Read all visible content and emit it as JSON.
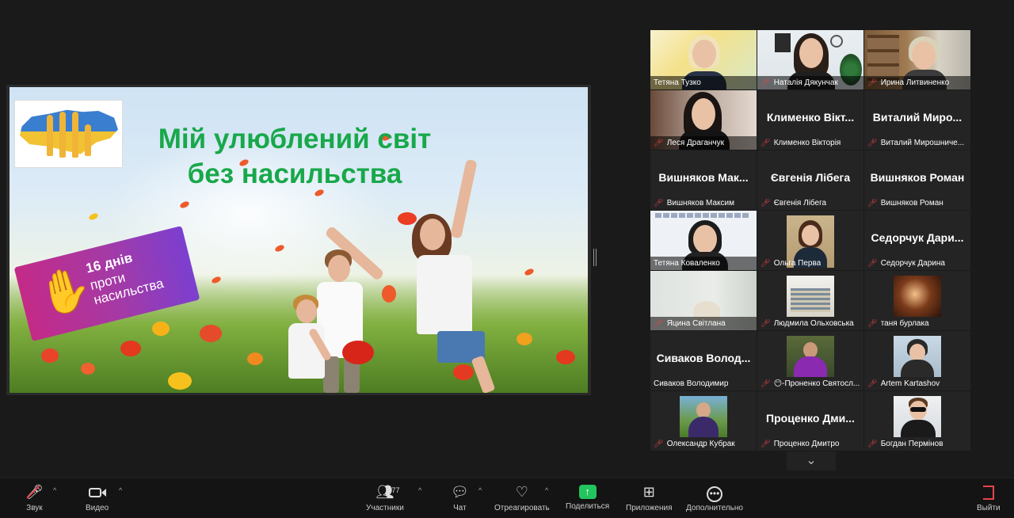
{
  "slide": {
    "title_line1": "Мій улюблений світ",
    "title_line2": "без насильства",
    "badge_line1": "16 днів",
    "badge_line2": "проти",
    "badge_line3": "насильства"
  },
  "participants": [
    {
      "name": "Тетяна Тузко",
      "muted": false,
      "video": true,
      "speaking": true
    },
    {
      "name": "Наталія Дякунчак",
      "muted": true,
      "video": true
    },
    {
      "name": "Ирина Литвиненко",
      "muted": true,
      "video": true
    },
    {
      "name": "Леся Драганчук",
      "muted": true,
      "video": true
    },
    {
      "name": "Клименко Вікторія",
      "big": "Клименко Вікт...",
      "muted": true,
      "video": false
    },
    {
      "name": "Виталий Мирошниче...",
      "big": "Виталий Миро...",
      "muted": true,
      "video": false
    },
    {
      "name": "Вишняков Максим",
      "big": "Вишняков Мак...",
      "muted": true,
      "video": false
    },
    {
      "name": "Євгенія Лібега",
      "big": "Євгенія Лібега",
      "muted": true,
      "video": false
    },
    {
      "name": "Вишняков Роман",
      "big": "Вишняков Роман",
      "muted": true,
      "video": false
    },
    {
      "name": "Тетяна  Коваленко",
      "muted": false,
      "video": true
    },
    {
      "name": "Ольга Перва",
      "muted": true,
      "video": true
    },
    {
      "name": "Седорчук Дарина",
      "big": "Седорчук Дари...",
      "muted": true,
      "video": false
    },
    {
      "name": "Яцина Світлана",
      "muted": true,
      "video": true
    },
    {
      "name": "Людмила Ольховська",
      "muted": true,
      "video": true
    },
    {
      "name": "таня бурлака",
      "muted": true,
      "video": true
    },
    {
      "name": "Сиваков Володимир",
      "big": "Сиваков Волод...",
      "muted": false,
      "video": false
    },
    {
      "name": "😶-Проненко Святосл...",
      "muted": true,
      "video": true
    },
    {
      "name": "Artem Kartashov",
      "muted": true,
      "video": true
    },
    {
      "name": "Олександр Кубрак",
      "muted": true,
      "video": true
    },
    {
      "name": "Проценко Дмитро",
      "big": "Проценко Дми...",
      "muted": true,
      "video": false
    },
    {
      "name": "Богдан Пермінов",
      "muted": true,
      "video": true
    }
  ],
  "toolbar": {
    "audio": "Звук",
    "video": "Видео",
    "participants": "Участники",
    "participants_count": "77",
    "chat": "Чат",
    "react": "Отреагировать",
    "share": "Поделиться",
    "apps": "Приложения",
    "more": "Дополнительно",
    "leave": "Выйти"
  },
  "colors": {
    "accent_green": "#23c55e",
    "muted_red": "#e8434a",
    "slide_title_green": "#18a84a"
  },
  "icons": {
    "audio": "mic-muted-icon",
    "video": "camera-icon",
    "participants": "people-icon",
    "chat": "chat-bubble-icon",
    "react": "heart-icon",
    "share": "share-arrow-icon",
    "apps": "apps-icon",
    "more": "ellipsis-icon",
    "leave": "leave-door-icon"
  }
}
